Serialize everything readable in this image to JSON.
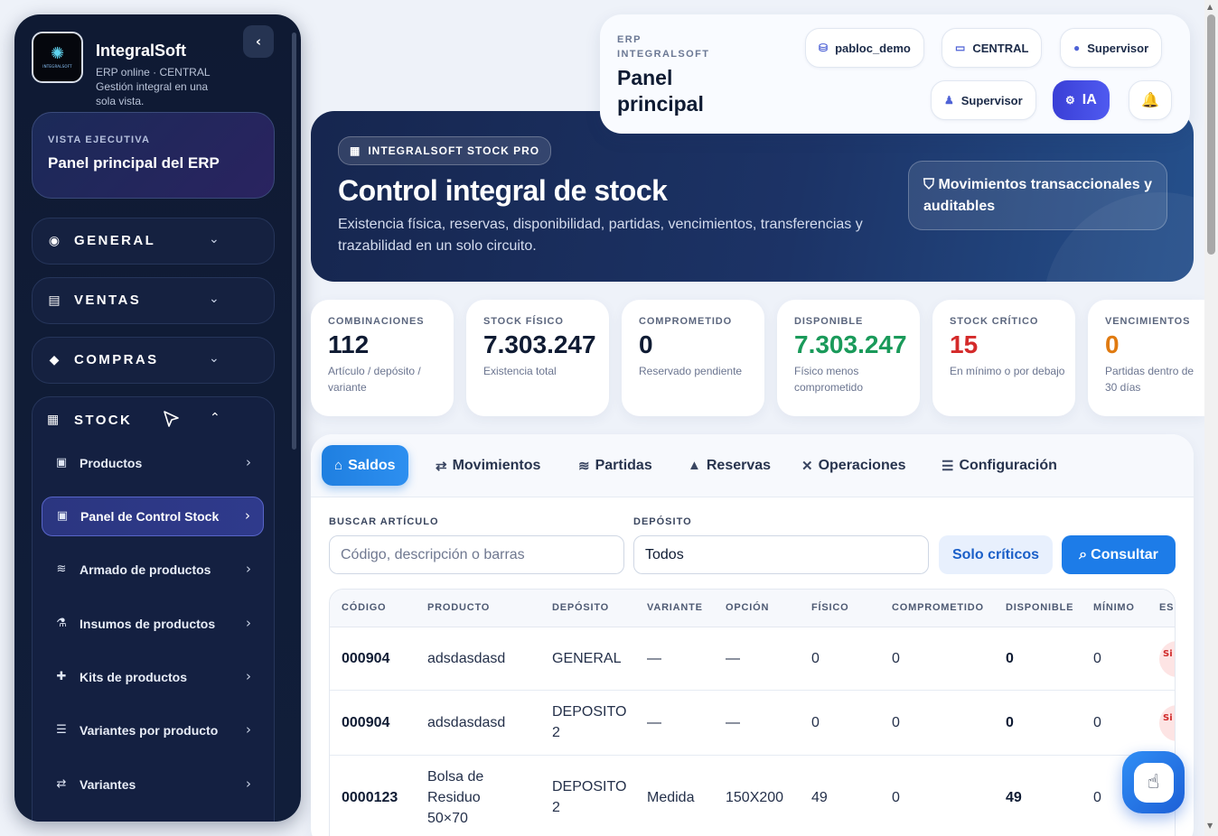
{
  "sidebar": {
    "brand": {
      "title": "IntegralSoft",
      "subtitle": "ERP online · CENTRAL Gestión integral en una sola vista.",
      "logo_text": "INTEGRALSOFT"
    },
    "exec": {
      "kicker": "VISTA EJECUTIVA",
      "title": "Panel principal del ERP"
    },
    "sections": [
      {
        "label": "GENERAL",
        "icon": "compass-icon"
      },
      {
        "label": "VENTAS",
        "icon": "receipt-icon"
      },
      {
        "label": "COMPRAS",
        "icon": "bag-icon"
      }
    ],
    "stock": {
      "label": "STOCK",
      "items": [
        {
          "label": "Productos"
        },
        {
          "label": "Panel de Control Stock"
        },
        {
          "label": "Armado de productos"
        },
        {
          "label": "Insumos de productos"
        },
        {
          "label": "Kits de productos"
        },
        {
          "label": "Variantes por producto"
        },
        {
          "label": "Variantes"
        }
      ]
    }
  },
  "header": {
    "kicker": "ERP INTEGRALSOFT",
    "title": "Panel principal",
    "pills": {
      "db": "pabloc_demo",
      "branch": "CENTRAL",
      "role": "Supervisor",
      "user": "Supervisor",
      "ai": "IA"
    }
  },
  "hero": {
    "badge": "INTEGRALSOFT STOCK PRO",
    "title": "Control integral de stock",
    "description": "Existencia física, reservas, disponibilidad, partidas, vencimientos, transferencias y trazabilidad en un solo circuito.",
    "box": "Movimientos transaccionales y auditables"
  },
  "kpis": [
    {
      "label": "COMBINACIONES",
      "value": "112",
      "desc": "Artículo / depósito / variante",
      "color": "#0f1b33"
    },
    {
      "label": "STOCK FÍSICO",
      "value": "7.303.247",
      "desc": "Existencia total",
      "color": "#0f1b33"
    },
    {
      "label": "COMPROMETIDO",
      "value": "0",
      "desc": "Reservado pendiente",
      "color": "#0f1b33"
    },
    {
      "label": "DISPONIBLE",
      "value": "7.303.247",
      "desc": "Físico menos comprometido",
      "color": "#1a9a5a"
    },
    {
      "label": "STOCK CRÍTICO",
      "value": "15",
      "desc": "En mínimo o por debajo",
      "color": "#d42a2a"
    },
    {
      "label": "VENCIMIENTOS",
      "value": "0",
      "desc": "Partidas dentro de 30 días",
      "color": "#e07a10"
    }
  ],
  "tabs": [
    {
      "label": "Saldos",
      "icon": "warehouse-icon"
    },
    {
      "label": "Movimientos",
      "icon": "arrows-icon"
    },
    {
      "label": "Partidas",
      "icon": "layers-icon"
    },
    {
      "label": "Reservas",
      "icon": "lock-icon"
    },
    {
      "label": "Operaciones",
      "icon": "tools-icon"
    },
    {
      "label": "Configuración",
      "icon": "sliders-icon"
    }
  ],
  "filters": {
    "search_label": "BUSCAR ARTÍCULO",
    "search_placeholder": "Código, descripción o barras",
    "deposit_label": "DEPÓSITO",
    "deposit_value": "Todos",
    "critical_button": "Solo críticos",
    "query_button": "Consultar"
  },
  "table": {
    "columns": [
      "CÓDIGO",
      "PRODUCTO",
      "DEPÓSITO",
      "VARIANTE",
      "OPCIÓN",
      "FÍSICO",
      "COMPROMETIDO",
      "DISPONIBLE",
      "MÍNIMO",
      "ES"
    ],
    "rows": [
      {
        "codigo": "000904",
        "producto": "adsdasdasd",
        "deposito": "GENERAL",
        "variante": "—",
        "opcion": "—",
        "fisico": "0",
        "comprometido": "0",
        "disponible": "0",
        "minimo": "0",
        "estado": "Si di"
      },
      {
        "codigo": "000904",
        "producto": "adsdasdasd",
        "deposito": "DEPOSITO 2",
        "variante": "—",
        "opcion": "—",
        "fisico": "0",
        "comprometido": "0",
        "disponible": "0",
        "minimo": "0",
        "estado": "Si di"
      },
      {
        "codigo": "0000123",
        "producto": "Bolsa de Residuo 50×70",
        "deposito": "DEPOSITO 2",
        "variante": "Medida",
        "opcion": "150X200",
        "fisico": "49",
        "comprometido": "0",
        "disponible": "49",
        "minimo": "0",
        "estado": ""
      }
    ]
  }
}
